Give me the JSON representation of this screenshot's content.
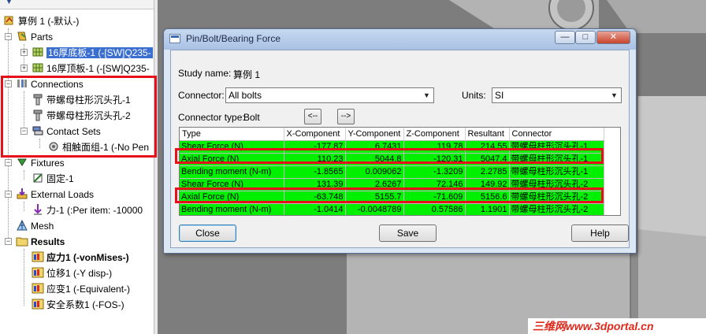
{
  "tree": {
    "root": "算例 1 (-默认-)",
    "parts": "Parts",
    "part1": "16厚底板-1 (-[SW]Q235-",
    "part2": "16厚顶板-1 (-[SW]Q235-",
    "connections": "Connections",
    "bolt1": "带螺母柱形沉头孔-1",
    "bolt2": "带螺母柱形沉头孔-2",
    "contact_sets": "Contact Sets",
    "contact1": "相触面组-1 (-No Pen",
    "fixtures": "Fixtures",
    "fixed1": "固定-1",
    "external_loads": "External Loads",
    "force1": "力-1 (:Per item: -10000",
    "mesh": "Mesh",
    "results": "Results",
    "res1": "应力1 (-vonMises-)",
    "res2": "位移1 (-Y disp-)",
    "res3": "应变1 (-Equivalent-)",
    "res4": "安全系数1 (-FOS-)"
  },
  "dialog": {
    "title": "Pin/Bolt/Bearing Force",
    "study_name_label": "Study name:",
    "study_name": "算例 1",
    "connector_label": "Connector:",
    "connector_value": "All bolts",
    "units_label": "Units:",
    "units_value": "SI",
    "connector_type_label": "Connector type:",
    "connector_type": "Bolt",
    "prev_label": "<--",
    "next_label": "-->",
    "close_label": "Close",
    "save_label": "Save",
    "help_label": "Help",
    "min_label": "—",
    "max_label": "□",
    "x_label": "✕"
  },
  "grid": {
    "headers": [
      "Type",
      "X-Component",
      "Y-Component",
      "Z-Component",
      "Resultant",
      "Connector"
    ],
    "rows": [
      [
        "Shear Force (N)",
        "-177.87",
        "6.7431",
        "119.78",
        "214.55",
        "带螺母柱形沉头孔-1"
      ],
      [
        "Axial Force (N)",
        "110.23",
        "5044.8",
        "-120.31",
        "5047.4",
        "带螺母柱形沉头孔-1"
      ],
      [
        "Bending moment (N-m)",
        "-1.8565",
        "0.009062",
        "-1.3209",
        "2.2785",
        "带螺母柱形沉头孔-1"
      ],
      [
        "Shear Force (N)",
        "131.39",
        "2.6267",
        "72.146",
        "149.92",
        "带螺母柱形沉头孔-2"
      ],
      [
        "Axial Force (N)",
        "-63.748",
        "5155.7",
        "-71.609",
        "5156.6",
        "带螺母柱形沉头孔-2"
      ],
      [
        "Bending moment (N-m)",
        "-1.0414",
        "-0.0048789",
        "0.57586",
        "1.1901",
        "带螺母柱形沉头孔-2"
      ]
    ]
  },
  "watermark": "三维网www.3dportal.cn"
}
